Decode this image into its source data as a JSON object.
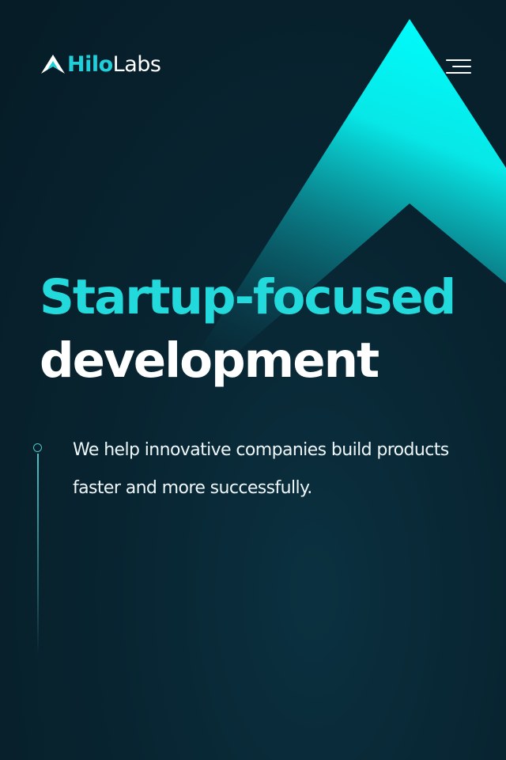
{
  "header": {
    "logo": {
      "icon": "mountain-logo-icon",
      "brand_first": "Hilo",
      "brand_second": "Labs"
    },
    "menu_icon": "hamburger-menu-icon"
  },
  "hero": {
    "headline_line1": "Startup-focused",
    "headline_line2": "development",
    "subtext": "We help innovative companies build products faster and more successfully."
  },
  "colors": {
    "background": "#082431",
    "accent": "#22d9dc",
    "text": "#ffffff"
  }
}
